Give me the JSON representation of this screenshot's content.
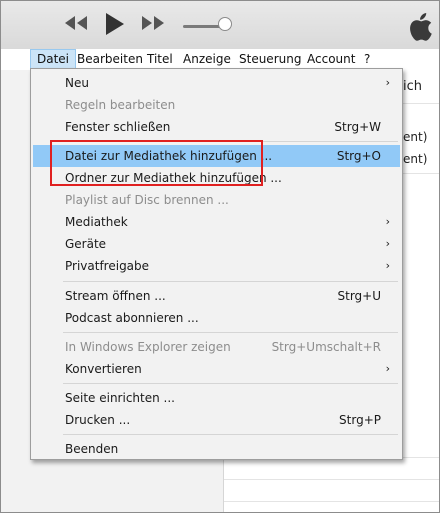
{
  "menubar": {
    "items": [
      "Datei",
      "Bearbeiten",
      "Titel",
      "Anzeige",
      "Steuerung",
      "Account",
      "?"
    ]
  },
  "background": {
    "partial_right_header": "ich",
    "partial_row1": "ent)",
    "partial_row2": "ent)"
  },
  "menu": {
    "items": [
      {
        "label": "Neu",
        "arrow": "›"
      },
      {
        "label": "Regeln bearbeiten"
      },
      {
        "label": "Fenster schließen",
        "shortcut": "Strg+W"
      },
      {
        "label": "Datei zur Mediathek hinzufügen ...",
        "shortcut": "Strg+O"
      },
      {
        "label": "Ordner zur Mediathek hinzufügen ..."
      },
      {
        "label": "Playlist auf Disc brennen ..."
      },
      {
        "label": "Mediathek",
        "arrow": "›"
      },
      {
        "label": "Geräte",
        "arrow": "›"
      },
      {
        "label": "Privatfreigabe",
        "arrow": "›"
      },
      {
        "label": "Stream öffnen ...",
        "shortcut": "Strg+U"
      },
      {
        "label": "Podcast abonnieren ..."
      },
      {
        "label": "In Windows Explorer zeigen",
        "shortcut": "Strg+Umschalt+R"
      },
      {
        "label": "Konvertieren",
        "arrow": "›"
      },
      {
        "label": "Seite einrichten ..."
      },
      {
        "label": "Drucken ...",
        "shortcut": "Strg+P"
      },
      {
        "label": "Beenden"
      }
    ]
  },
  "colors": {
    "highlight": "#91c9f7",
    "annotation_box": "#e02020",
    "disabled_text": "#8d8d8d"
  }
}
